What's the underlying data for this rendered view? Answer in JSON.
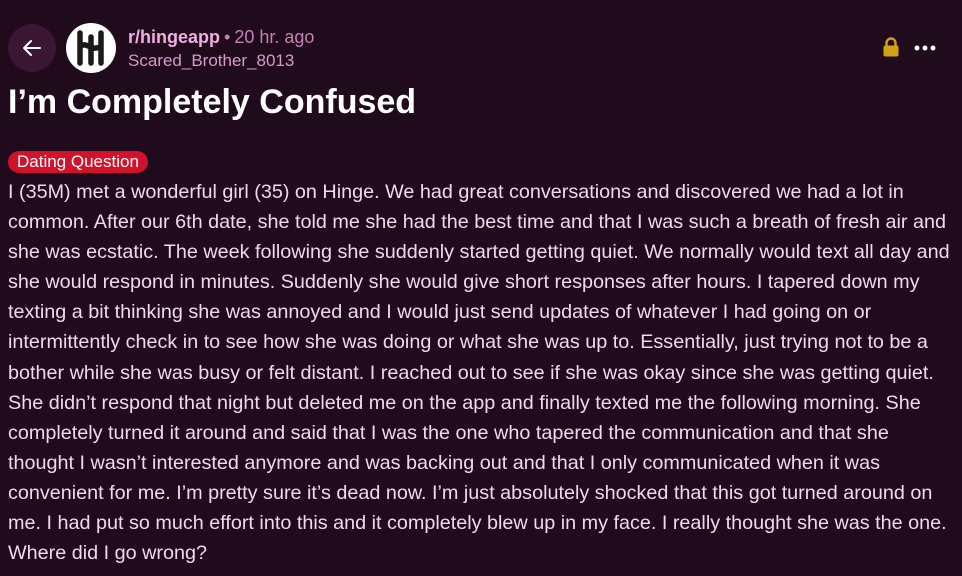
{
  "header": {
    "subreddit": "r/hingeapp",
    "separator": "•",
    "time_ago": "20 hr. ago",
    "author": "Scared_Brother_8013"
  },
  "icons": {
    "back": "arrow-left-icon",
    "avatar": "hinge-logo",
    "lock": "lock-icon",
    "more": "more-horizontal-icon"
  },
  "colors": {
    "background": "#1f0b1c",
    "flair": "#d0122b",
    "lock": "#d4a017",
    "accent": "#f0aee0"
  },
  "post": {
    "title": "I’m Completely Confused",
    "flair": "Dating Question",
    "body": "I (35M) met a wonderful girl (35) on Hinge. We had great conversations and discovered we had a lot in common. After our 6th date, she told me she had the best time and that I was such a breath of fresh air and she was ecstatic. The week following she suddenly started getting quiet. We normally would text all day and she would respond in minutes. Suddenly she would give short responses after hours. I tapered down my texting a bit thinking she was annoyed and I would just send updates of whatever I had going on or intermittently check in to see how she was doing or what she was up to. Essentially, just trying not to be a bother while she was busy or felt distant. I reached out to see if she was okay since she was getting quiet. She didn’t respond that night but deleted me on the app and finally texted me the following morning. She completely turned it around and said that I was the one who tapered the communication and that she thought I wasn’t interested anymore and was backing out and that I only communicated when it was convenient for me. I’m pretty sure it’s dead now. I’m just absolutely shocked that this got turned around on me. I had put so much effort into this and it completely blew up in my face. I really thought she was the one. Where did I go wrong?"
  }
}
